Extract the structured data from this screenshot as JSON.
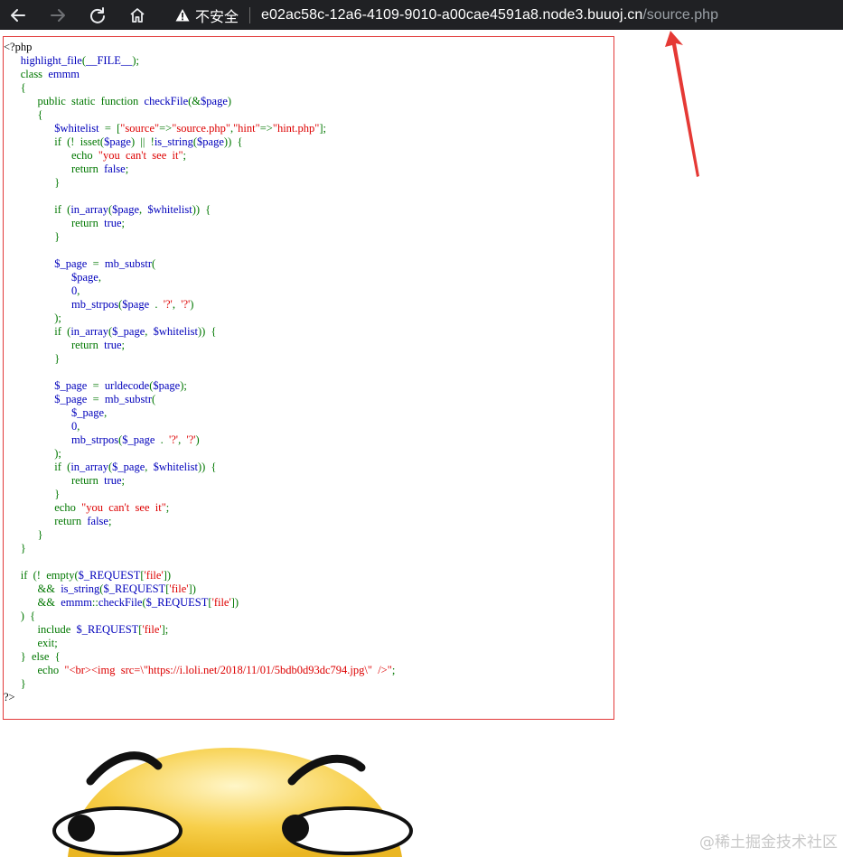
{
  "browser": {
    "security_label": "不安全",
    "url_host": "e02ac58c-12a6-4109-9010-a00cae4591a8.node3.buuoj.cn",
    "url_path": "/source.php"
  },
  "code": {
    "lines": [
      [
        [
          "html",
          "<?php"
        ]
      ],
      [
        [
          "default",
          "      highlight_file"
        ],
        [
          "keyword",
          "("
        ],
        [
          "default",
          "__FILE__"
        ],
        [
          "keyword",
          ");"
        ]
      ],
      [
        [
          "keyword",
          "      class  "
        ],
        [
          "default",
          "emmm"
        ]
      ],
      [
        [
          "keyword",
          "      {"
        ]
      ],
      [
        [
          "keyword",
          "            public  static  function  "
        ],
        [
          "default",
          "checkFile"
        ],
        [
          "keyword",
          "(&"
        ],
        [
          "default",
          "$page"
        ],
        [
          "keyword",
          ")"
        ]
      ],
      [
        [
          "keyword",
          "            {"
        ]
      ],
      [
        [
          "default",
          "                  $whitelist  "
        ],
        [
          "keyword",
          "=  ["
        ],
        [
          "string",
          "\"source\""
        ],
        [
          "keyword",
          "=>"
        ],
        [
          "string",
          "\"source.php\""
        ],
        [
          "keyword",
          ","
        ],
        [
          "string",
          "\"hint\""
        ],
        [
          "keyword",
          "=>"
        ],
        [
          "string",
          "\"hint.php\""
        ],
        [
          "keyword",
          "];"
        ]
      ],
      [
        [
          "keyword",
          "                  if  (!  isset("
        ],
        [
          "default",
          "$page"
        ],
        [
          "keyword",
          ")  ||  !"
        ],
        [
          "default",
          "is_string"
        ],
        [
          "keyword",
          "("
        ],
        [
          "default",
          "$page"
        ],
        [
          "keyword",
          "))  {"
        ]
      ],
      [
        [
          "keyword",
          "                        echo  "
        ],
        [
          "string",
          "\"you  can't  see  it\""
        ],
        [
          "keyword",
          ";"
        ]
      ],
      [
        [
          "keyword",
          "                        return  "
        ],
        [
          "default",
          "false"
        ],
        [
          "keyword",
          ";"
        ]
      ],
      [
        [
          "keyword",
          "                  }"
        ]
      ],
      [
        [
          "default",
          " "
        ]
      ],
      [
        [
          "keyword",
          "                  if  ("
        ],
        [
          "default",
          "in_array"
        ],
        [
          "keyword",
          "("
        ],
        [
          "default",
          "$page"
        ],
        [
          "keyword",
          ",  "
        ],
        [
          "default",
          "$whitelist"
        ],
        [
          "keyword",
          "))  {"
        ]
      ],
      [
        [
          "keyword",
          "                        return  "
        ],
        [
          "default",
          "true"
        ],
        [
          "keyword",
          ";"
        ]
      ],
      [
        [
          "keyword",
          "                  }"
        ]
      ],
      [
        [
          "default",
          " "
        ]
      ],
      [
        [
          "default",
          "                  $_page  "
        ],
        [
          "keyword",
          "=  "
        ],
        [
          "default",
          "mb_substr"
        ],
        [
          "keyword",
          "("
        ]
      ],
      [
        [
          "default",
          "                        $page"
        ],
        [
          "keyword",
          ","
        ]
      ],
      [
        [
          "default",
          "                        0"
        ],
        [
          "keyword",
          ","
        ]
      ],
      [
        [
          "default",
          "                        mb_strpos"
        ],
        [
          "keyword",
          "("
        ],
        [
          "default",
          "$page  "
        ],
        [
          "keyword",
          ".  "
        ],
        [
          "string",
          "'?'"
        ],
        [
          "keyword",
          ",  "
        ],
        [
          "string",
          "'?'"
        ],
        [
          "keyword",
          ")"
        ]
      ],
      [
        [
          "keyword",
          "                  );"
        ]
      ],
      [
        [
          "keyword",
          "                  if  ("
        ],
        [
          "default",
          "in_array"
        ],
        [
          "keyword",
          "("
        ],
        [
          "default",
          "$_page"
        ],
        [
          "keyword",
          ",  "
        ],
        [
          "default",
          "$whitelist"
        ],
        [
          "keyword",
          "))  {"
        ]
      ],
      [
        [
          "keyword",
          "                        return  "
        ],
        [
          "default",
          "true"
        ],
        [
          "keyword",
          ";"
        ]
      ],
      [
        [
          "keyword",
          "                  }"
        ]
      ],
      [
        [
          "default",
          " "
        ]
      ],
      [
        [
          "default",
          "                  $_page  "
        ],
        [
          "keyword",
          "=  "
        ],
        [
          "default",
          "urldecode"
        ],
        [
          "keyword",
          "("
        ],
        [
          "default",
          "$page"
        ],
        [
          "keyword",
          ");"
        ]
      ],
      [
        [
          "default",
          "                  $_page  "
        ],
        [
          "keyword",
          "=  "
        ],
        [
          "default",
          "mb_substr"
        ],
        [
          "keyword",
          "("
        ]
      ],
      [
        [
          "default",
          "                        $_page"
        ],
        [
          "keyword",
          ","
        ]
      ],
      [
        [
          "default",
          "                        0"
        ],
        [
          "keyword",
          ","
        ]
      ],
      [
        [
          "default",
          "                        mb_strpos"
        ],
        [
          "keyword",
          "("
        ],
        [
          "default",
          "$_page  "
        ],
        [
          "keyword",
          ".  "
        ],
        [
          "string",
          "'?'"
        ],
        [
          "keyword",
          ",  "
        ],
        [
          "string",
          "'?'"
        ],
        [
          "keyword",
          ")"
        ]
      ],
      [
        [
          "keyword",
          "                  );"
        ]
      ],
      [
        [
          "keyword",
          "                  if  ("
        ],
        [
          "default",
          "in_array"
        ],
        [
          "keyword",
          "("
        ],
        [
          "default",
          "$_page"
        ],
        [
          "keyword",
          ",  "
        ],
        [
          "default",
          "$whitelist"
        ],
        [
          "keyword",
          "))  {"
        ]
      ],
      [
        [
          "keyword",
          "                        return  "
        ],
        [
          "default",
          "true"
        ],
        [
          "keyword",
          ";"
        ]
      ],
      [
        [
          "keyword",
          "                  }"
        ]
      ],
      [
        [
          "keyword",
          "                  echo  "
        ],
        [
          "string",
          "\"you  can't  see  it\""
        ],
        [
          "keyword",
          ";"
        ]
      ],
      [
        [
          "keyword",
          "                  return  "
        ],
        [
          "default",
          "false"
        ],
        [
          "keyword",
          ";"
        ]
      ],
      [
        [
          "keyword",
          "            }"
        ]
      ],
      [
        [
          "keyword",
          "      }"
        ]
      ],
      [
        [
          "default",
          " "
        ]
      ],
      [
        [
          "keyword",
          "      if  (!  empty("
        ],
        [
          "default",
          "$_REQUEST"
        ],
        [
          "keyword",
          "["
        ],
        [
          "string",
          "'file'"
        ],
        [
          "keyword",
          "])"
        ]
      ],
      [
        [
          "keyword",
          "            &&  "
        ],
        [
          "default",
          "is_string"
        ],
        [
          "keyword",
          "("
        ],
        [
          "default",
          "$_REQUEST"
        ],
        [
          "keyword",
          "["
        ],
        [
          "string",
          "'file'"
        ],
        [
          "keyword",
          "])"
        ]
      ],
      [
        [
          "keyword",
          "            &&  "
        ],
        [
          "default",
          "emmm"
        ],
        [
          "keyword",
          "::"
        ],
        [
          "default",
          "checkFile"
        ],
        [
          "keyword",
          "("
        ],
        [
          "default",
          "$_REQUEST"
        ],
        [
          "keyword",
          "["
        ],
        [
          "string",
          "'file'"
        ],
        [
          "keyword",
          "])"
        ]
      ],
      [
        [
          "keyword",
          "      )  {"
        ]
      ],
      [
        [
          "keyword",
          "            include  "
        ],
        [
          "default",
          "$_REQUEST"
        ],
        [
          "keyword",
          "["
        ],
        [
          "string",
          "'file'"
        ],
        [
          "keyword",
          "];"
        ]
      ],
      [
        [
          "keyword",
          "            exit;"
        ]
      ],
      [
        [
          "keyword",
          "      }  else  {"
        ]
      ],
      [
        [
          "keyword",
          "            echo  "
        ],
        [
          "string",
          "\"<br><img  src=\\\"https://i.loli.net/2018/11/01/5bdb0d93dc794.jpg\\\"  />\""
        ],
        [
          "keyword",
          ";"
        ]
      ],
      [
        [
          "keyword",
          "      }"
        ]
      ],
      [
        [
          "html",
          "?>"
        ]
      ]
    ]
  },
  "colors": {
    "toolbar_bg": "#202124",
    "php_default": "#0000bb",
    "php_keyword": "#007700",
    "php_string": "#dd0000",
    "annotation_arrow": "#e53935",
    "box_border": "#e23a3a"
  },
  "icons": {
    "back": "arrow-left-icon",
    "forward": "arrow-right-icon",
    "reload": "reload-icon",
    "home": "home-icon",
    "security": "warning-triangle-icon"
  },
  "watermark": "@稀土掘金技术社区"
}
